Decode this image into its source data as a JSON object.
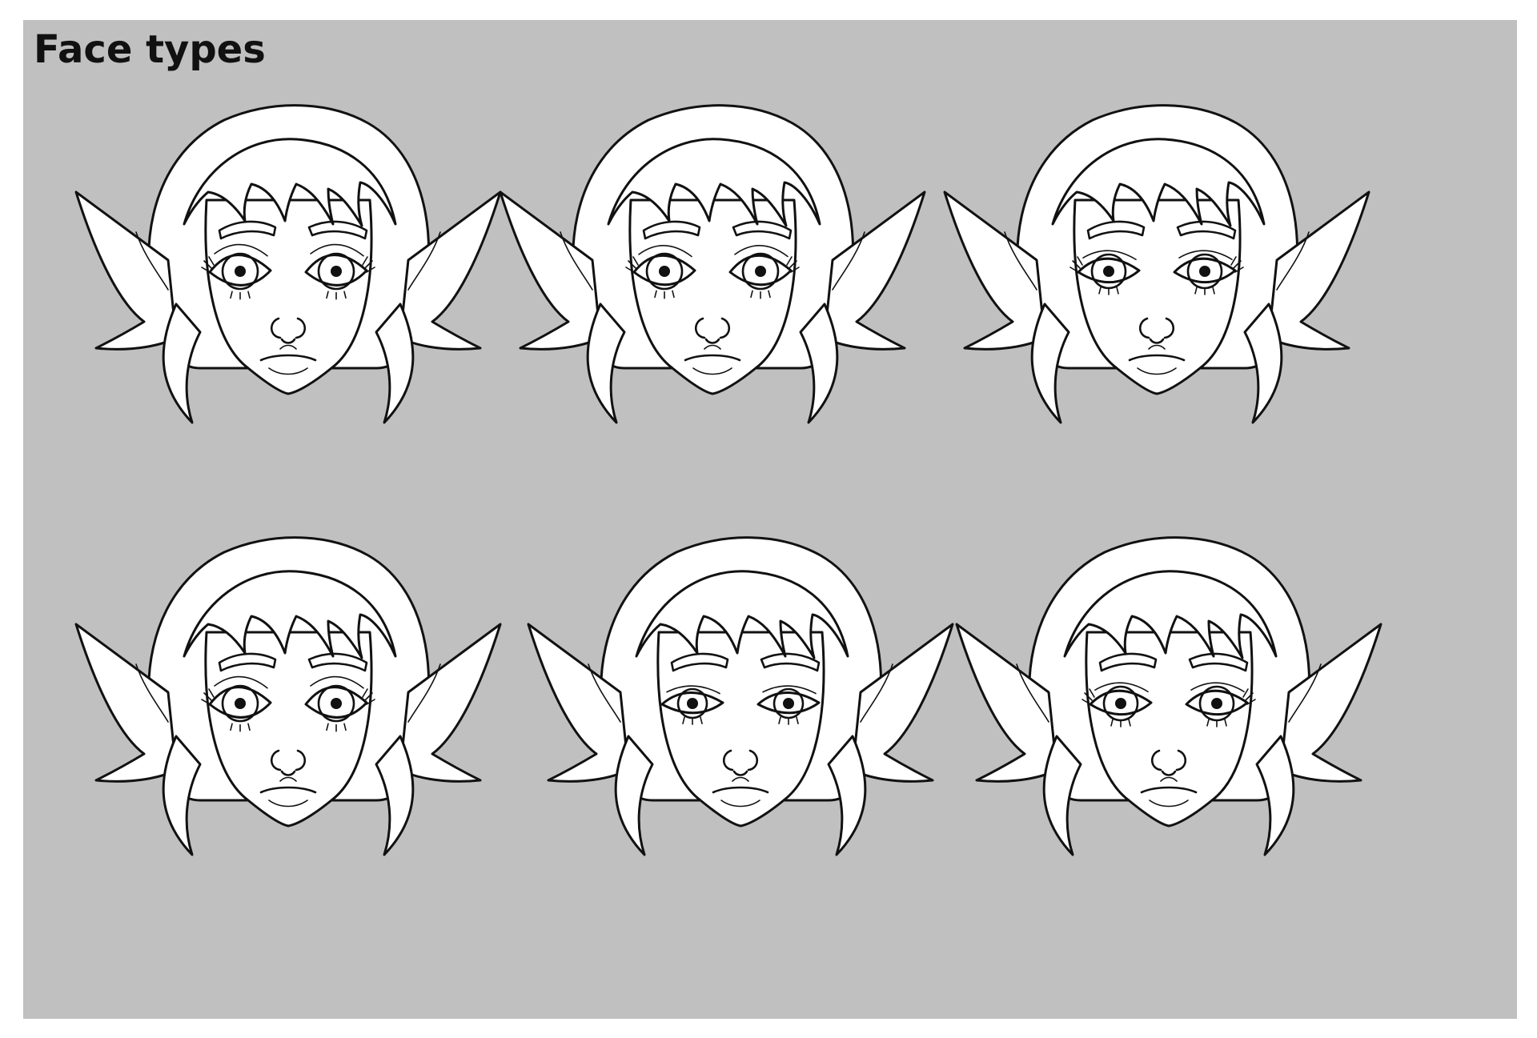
{
  "title": "Face types",
  "colors": {
    "background": "#c0c0c0",
    "line": "#111111",
    "fill": "#ffffff"
  },
  "faces": [
    {
      "name": "face-type-1",
      "eye_style": "wide",
      "lashes": true
    },
    {
      "name": "face-type-2",
      "eye_style": "round",
      "lashes": true
    },
    {
      "name": "face-type-3",
      "eye_style": "almond",
      "lashes": true
    },
    {
      "name": "face-type-4",
      "eye_style": "wide",
      "lashes": true
    },
    {
      "name": "face-type-5",
      "eye_style": "narrow",
      "lashes": false
    },
    {
      "name": "face-type-6",
      "eye_style": "almond",
      "lashes": true
    }
  ]
}
